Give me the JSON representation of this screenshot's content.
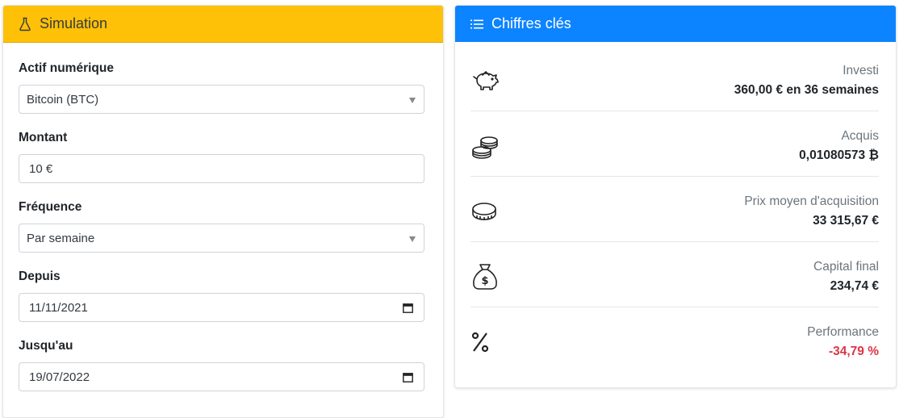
{
  "simulation": {
    "title": "Simulation",
    "icon": "flask-icon",
    "header_color": "#ffc107",
    "fields": {
      "asset": {
        "label": "Actif numérique",
        "value": "Bitcoin (BTC)"
      },
      "amount": {
        "label": "Montant",
        "value": "10 €"
      },
      "frequency": {
        "label": "Fréquence",
        "value": "Par semaine"
      },
      "since": {
        "label": "Depuis",
        "value": "11/11/2021"
      },
      "until": {
        "label": "Jusqu'au",
        "value": "19/07/2022"
      }
    }
  },
  "key_figures": {
    "title": "Chiffres clés",
    "icon": "list-icon",
    "header_color": "#0d84ff",
    "items": [
      {
        "label": "Investi",
        "value": "360,00 € en 36 semaines",
        "icon": "piggy-bank-icon"
      },
      {
        "label": "Acquis",
        "value": "0,01080573 ₿",
        "icon": "coin-stack-icon"
      },
      {
        "label": "Prix moyen d'acquisition",
        "value": "33 315,67 €",
        "icon": "coin-icon"
      },
      {
        "label": "Capital final",
        "value": "234,74 €",
        "icon": "money-bag-icon"
      },
      {
        "label": "Performance",
        "value": "-34,79 %",
        "icon": "percent-icon",
        "value_color": "#dc3545"
      }
    ]
  }
}
